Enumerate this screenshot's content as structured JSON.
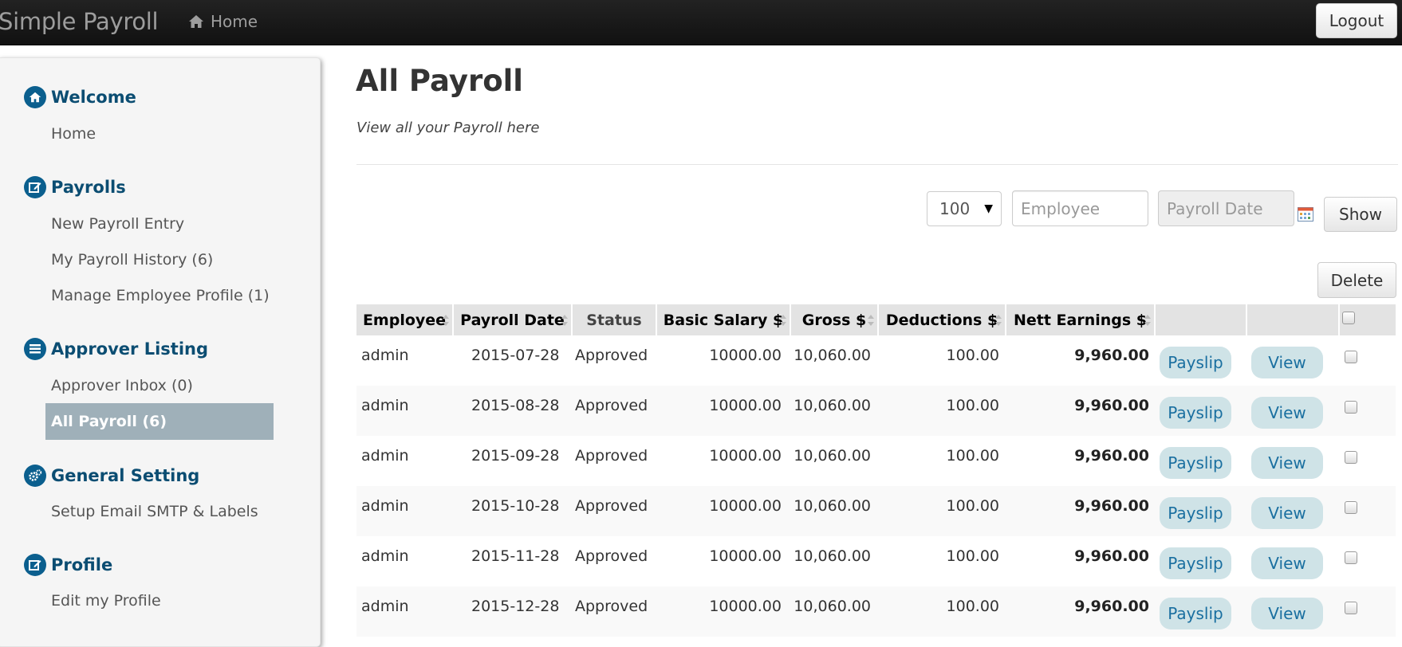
{
  "navbar": {
    "brand": "Simple Payroll",
    "home_label": "Home",
    "logout_label": "Logout"
  },
  "sidebar": {
    "sections": [
      {
        "title": "Welcome",
        "icon": "home-icon",
        "items": [
          "Home"
        ]
      },
      {
        "title": "Payrolls",
        "icon": "edit-icon",
        "items": [
          "New Payroll Entry",
          "My Payroll History (6)",
          "Manage Employee Profile (1)"
        ]
      },
      {
        "title": "Approver Listing",
        "icon": "list-icon",
        "items": [
          "Approver Inbox (0)",
          "All Payroll (6)"
        ]
      },
      {
        "title": "General Setting",
        "icon": "gears-icon",
        "items": [
          "Setup Email SMTP & Labels"
        ]
      },
      {
        "title": "Profile",
        "icon": "edit-icon",
        "items": [
          "Edit my Profile"
        ]
      }
    ],
    "active_item": "All Payroll (6)"
  },
  "main": {
    "title": "All Payroll",
    "subtitle": "View all your Payroll here"
  },
  "filters": {
    "page_size": "100",
    "employee_placeholder": "Employee",
    "date_placeholder": "Payroll Date",
    "show_label": "Show",
    "delete_label": "Delete"
  },
  "table": {
    "columns": [
      "Employee",
      "Payroll Date",
      "Status",
      "Basic Salary $",
      "Gross $",
      "Deductions $",
      "Nett Earnings $"
    ],
    "rows": [
      {
        "employee": "admin",
        "date": "2015-07-28",
        "status": "Approved",
        "basic": "10000.00",
        "gross": "10,060.00",
        "deductions": "100.00",
        "nett": "9,960.00"
      },
      {
        "employee": "admin",
        "date": "2015-08-28",
        "status": "Approved",
        "basic": "10000.00",
        "gross": "10,060.00",
        "deductions": "100.00",
        "nett": "9,960.00"
      },
      {
        "employee": "admin",
        "date": "2015-09-28",
        "status": "Approved",
        "basic": "10000.00",
        "gross": "10,060.00",
        "deductions": "100.00",
        "nett": "9,960.00"
      },
      {
        "employee": "admin",
        "date": "2015-10-28",
        "status": "Approved",
        "basic": "10000.00",
        "gross": "10,060.00",
        "deductions": "100.00",
        "nett": "9,960.00"
      },
      {
        "employee": "admin",
        "date": "2015-11-28",
        "status": "Approved",
        "basic": "10000.00",
        "gross": "10,060.00",
        "deductions": "100.00",
        "nett": "9,960.00"
      },
      {
        "employee": "admin",
        "date": "2015-12-28",
        "status": "Approved",
        "basic": "10000.00",
        "gross": "10,060.00",
        "deductions": "100.00",
        "nett": "9,960.00"
      }
    ],
    "payslip_label": "Payslip",
    "view_label": "View"
  },
  "colors": {
    "navbar": "#111111",
    "section_heading": "#0b4d72",
    "active_item_bg": "#9fb0b9",
    "pill_bg": "#cfe3e7",
    "pill_text": "#1a6fa0"
  }
}
